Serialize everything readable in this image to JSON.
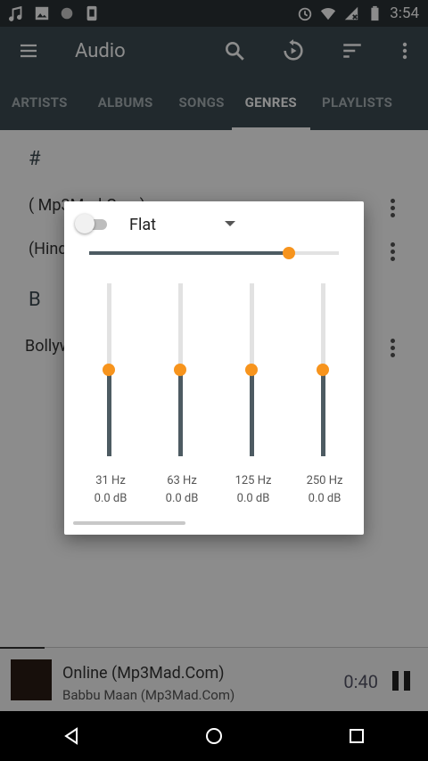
{
  "statusbar": {
    "time": "3:54"
  },
  "toolbar": {
    "title": "Audio"
  },
  "tabs": [
    {
      "label": "ARTISTS",
      "active": false
    },
    {
      "label": "ALBUMS",
      "active": false
    },
    {
      "label": "SONGS",
      "active": false
    },
    {
      "label": "GENRES",
      "active": true
    },
    {
      "label": "PLAYLISTS",
      "active": false
    }
  ],
  "list": {
    "sections": [
      "#",
      "B"
    ],
    "rows": [
      "( Mp3Mad.Com)",
      "(Hindi)",
      "Bollywood"
    ]
  },
  "miniplayer": {
    "title": "Online (Mp3Mad.Com)",
    "artist": "Babbu Maan (Mp3Mad.Com)",
    "time": "0:40"
  },
  "equalizer": {
    "enabled": false,
    "preset": "Flat",
    "master_level": 0.8,
    "bands": [
      {
        "freq": "31 Hz",
        "gain": "0.0 dB",
        "level": 0.5
      },
      {
        "freq": "63 Hz",
        "gain": "0.0 dB",
        "level": 0.5
      },
      {
        "freq": "125 Hz",
        "gain": "0.0 dB",
        "level": 0.5
      },
      {
        "freq": "250 Hz",
        "gain": "0.0 dB",
        "level": 0.5
      }
    ],
    "accent_color": "#f7941d",
    "track_color": "#4d5b62"
  }
}
